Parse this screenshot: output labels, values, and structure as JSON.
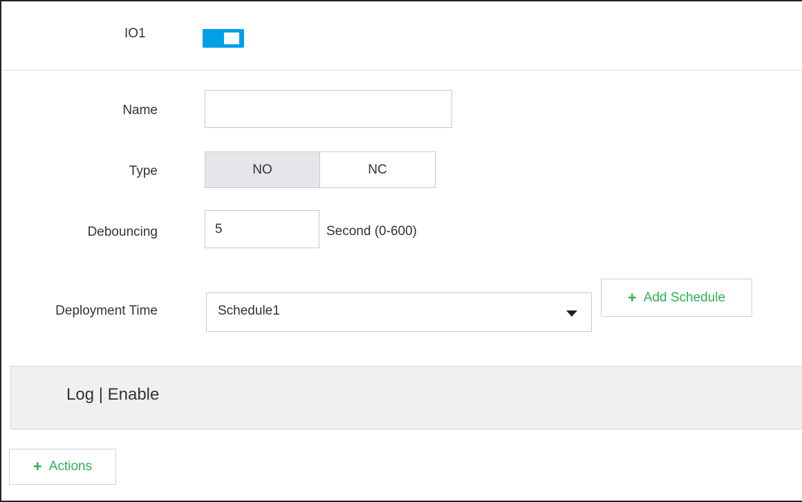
{
  "io": {
    "label": "IO1",
    "enabled": true
  },
  "form": {
    "name": {
      "label": "Name",
      "value": "",
      "placeholder": ""
    },
    "type": {
      "label": "Type",
      "options": [
        "NO",
        "NC"
      ],
      "selected": "NO"
    },
    "debouncing": {
      "label": "Debouncing",
      "value": "5",
      "unit": "Second (0-600)"
    },
    "deployment": {
      "label": "Deployment Time",
      "value": "Schedule1",
      "add_label": "Add Schedule"
    }
  },
  "log": {
    "label": "Log | Enable"
  },
  "actions": {
    "label": "Actions"
  },
  "colors": {
    "toggle_on": "#00a0e9",
    "green_action": "#2eb050",
    "segment_selected": "#e6e6ea"
  }
}
